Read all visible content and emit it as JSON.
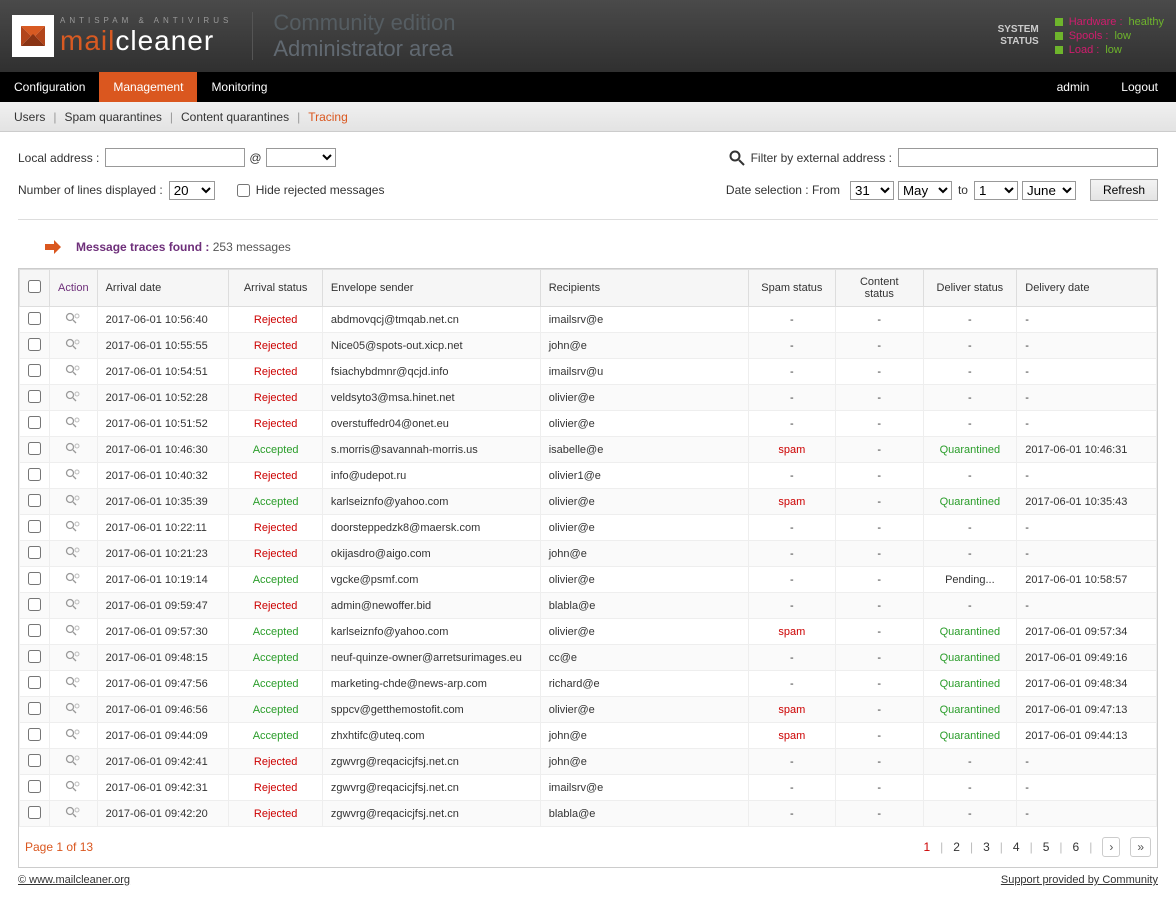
{
  "header": {
    "tag": "ANTISPAM & ANTIVIRUS",
    "brand1": "mail",
    "brand2": "cleaner",
    "edition1": "Community edition",
    "edition2": "Administrator area",
    "status_label1": "SYSTEM",
    "status_label2": "STATUS",
    "statuses": [
      {
        "k": "Hardware :",
        "v": "healthy"
      },
      {
        "k": "Spools :",
        "v": "low"
      },
      {
        "k": "Load :",
        "v": "low"
      }
    ]
  },
  "nav": {
    "items": [
      "Configuration",
      "Management",
      "Monitoring"
    ],
    "active_index": 1,
    "user": "admin",
    "logout": "Logout"
  },
  "subnav": {
    "items": [
      "Users",
      "Spam quarantines",
      "Content quarantines",
      "Tracing"
    ],
    "active_index": 3
  },
  "filters": {
    "local_label": "Local address :",
    "at": "@",
    "lines_label": "Number of lines displayed :",
    "lines_value": "20",
    "hide_label": "Hide rejected messages",
    "ext_label": "Filter by external address :",
    "date_label": "Date selection : From",
    "from_day": "31",
    "from_month": "May",
    "to_label": "to",
    "to_day": "1",
    "to_month": "June",
    "refresh": "Refresh"
  },
  "traces": {
    "title": "Message traces found :",
    "count": "253 messages"
  },
  "columns": [
    "Action",
    "Arrival date",
    "Arrival status",
    "Envelope sender",
    "Recipients",
    "Spam status",
    "Content status",
    "Deliver status",
    "Delivery date"
  ],
  "rows": [
    {
      "date": "2017-06-01 10:56:40",
      "status": "Rejected",
      "sender": "abdmovqcj@tmqab.net.cn",
      "recip": "imailsrv@e",
      "spam": "-",
      "content": "-",
      "deliver": "-",
      "deldate": "-"
    },
    {
      "date": "2017-06-01 10:55:55",
      "status": "Rejected",
      "sender": "Nice05@spots-out.xicp.net",
      "recip": "john@e",
      "spam": "-",
      "content": "-",
      "deliver": "-",
      "deldate": "-"
    },
    {
      "date": "2017-06-01 10:54:51",
      "status": "Rejected",
      "sender": "fsiachybdmnr@qcjd.info",
      "recip": "imailsrv@u",
      "spam": "-",
      "content": "-",
      "deliver": "-",
      "deldate": "-"
    },
    {
      "date": "2017-06-01 10:52:28",
      "status": "Rejected",
      "sender": "veldsyto3@msa.hinet.net",
      "recip": "olivier@e",
      "spam": "-",
      "content": "-",
      "deliver": "-",
      "deldate": "-"
    },
    {
      "date": "2017-06-01 10:51:52",
      "status": "Rejected",
      "sender": "overstuffedr04@onet.eu",
      "recip": "olivier@e",
      "spam": "-",
      "content": "-",
      "deliver": "-",
      "deldate": "-"
    },
    {
      "date": "2017-06-01 10:46:30",
      "status": "Accepted",
      "sender": "s.morris@savannah-morris.us",
      "recip": "isabelle@e",
      "spam": "spam",
      "content": "-",
      "deliver": "Quarantined",
      "deldate": "2017-06-01 10:46:31"
    },
    {
      "date": "2017-06-01 10:40:32",
      "status": "Rejected",
      "sender": "info@udepot.ru",
      "recip": "olivier1@e",
      "spam": "-",
      "content": "-",
      "deliver": "-",
      "deldate": "-"
    },
    {
      "date": "2017-06-01 10:35:39",
      "status": "Accepted",
      "sender": "karlseiznfo@yahoo.com",
      "recip": "olivier@e",
      "spam": "spam",
      "content": "-",
      "deliver": "Quarantined",
      "deldate": "2017-06-01 10:35:43"
    },
    {
      "date": "2017-06-01 10:22:11",
      "status": "Rejected",
      "sender": "doorsteppedzk8@maersk.com",
      "recip": "olivier@e",
      "spam": "-",
      "content": "-",
      "deliver": "-",
      "deldate": "-"
    },
    {
      "date": "2017-06-01 10:21:23",
      "status": "Rejected",
      "sender": "okijasdro@aigo.com",
      "recip": "john@e",
      "spam": "-",
      "content": "-",
      "deliver": "-",
      "deldate": "-"
    },
    {
      "date": "2017-06-01 10:19:14",
      "status": "Accepted",
      "sender": "vgcke@psmf.com",
      "recip": "olivier@e",
      "spam": "-",
      "content": "-",
      "deliver": "Pending...",
      "deldate": "2017-06-01 10:58:57"
    },
    {
      "date": "2017-06-01 09:59:47",
      "status": "Rejected",
      "sender": "admin@newoffer.bid",
      "recip": "blabla@e",
      "spam": "-",
      "content": "-",
      "deliver": "-",
      "deldate": "-"
    },
    {
      "date": "2017-06-01 09:57:30",
      "status": "Accepted",
      "sender": "karlseiznfo@yahoo.com",
      "recip": "olivier@e",
      "spam": "spam",
      "content": "-",
      "deliver": "Quarantined",
      "deldate": "2017-06-01 09:57:34"
    },
    {
      "date": "2017-06-01 09:48:15",
      "status": "Accepted",
      "sender": "neuf-quinze-owner@arretsurimages.eu",
      "recip": "cc@e",
      "spam": "-",
      "content": "-",
      "deliver": "Quarantined",
      "deldate": "2017-06-01 09:49:16"
    },
    {
      "date": "2017-06-01 09:47:56",
      "status": "Accepted",
      "sender": "marketing-chde@news-arp.com",
      "recip": "richard@e",
      "spam": "-",
      "content": "-",
      "deliver": "Quarantined",
      "deldate": "2017-06-01 09:48:34"
    },
    {
      "date": "2017-06-01 09:46:56",
      "status": "Accepted",
      "sender": "sppcv@getthemostofit.com",
      "recip": "olivier@e",
      "spam": "spam",
      "content": "-",
      "deliver": "Quarantined",
      "deldate": "2017-06-01 09:47:13"
    },
    {
      "date": "2017-06-01 09:44:09",
      "status": "Accepted",
      "sender": "zhxhtifc@uteq.com",
      "recip": "john@e",
      "spam": "spam",
      "content": "-",
      "deliver": "Quarantined",
      "deldate": "2017-06-01 09:44:13"
    },
    {
      "date": "2017-06-01 09:42:41",
      "status": "Rejected",
      "sender": "zgwvrg@reqacicjfsj.net.cn",
      "recip": "john@e",
      "spam": "-",
      "content": "-",
      "deliver": "-",
      "deldate": "-"
    },
    {
      "date": "2017-06-01 09:42:31",
      "status": "Rejected",
      "sender": "zgwvrg@reqacicjfsj.net.cn",
      "recip": "imailsrv@e",
      "spam": "-",
      "content": "-",
      "deliver": "-",
      "deldate": "-"
    },
    {
      "date": "2017-06-01 09:42:20",
      "status": "Rejected",
      "sender": "zgwvrg@reqacicjfsj.net.cn",
      "recip": "blabla@e",
      "spam": "-",
      "content": "-",
      "deliver": "-",
      "deldate": "-"
    }
  ],
  "pager": {
    "info": "Page 1 of 13",
    "pages": [
      "1",
      "2",
      "3",
      "4",
      "5",
      "6"
    ],
    "cur": 0
  },
  "footer": {
    "site": "© www.mailcleaner.org",
    "support": "Support provided by Community"
  }
}
